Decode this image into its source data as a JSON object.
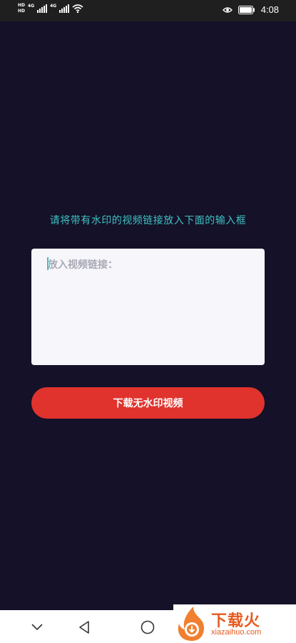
{
  "status_bar": {
    "hd_top": "HD",
    "hd_bottom": "HD",
    "net_1": "4G",
    "net_2": "4G",
    "time": "4:08"
  },
  "main": {
    "prompt": "请将带有水印的视频链接放入下面的输入框",
    "input_placeholder": "放入视频链接：",
    "download_button": "下载无水印视频"
  },
  "watermark": {
    "brand": "下载火",
    "url": "xiazaihuo.com"
  },
  "colors": {
    "background": "#141129",
    "accent_text": "#3fc2c1",
    "button": "#e0332d",
    "watermark": "#e55a1f"
  },
  "icons": {
    "nav_back": "back-triangle-icon",
    "nav_home": "home-circle-icon",
    "nav_collapse": "chevron-down-icon"
  }
}
